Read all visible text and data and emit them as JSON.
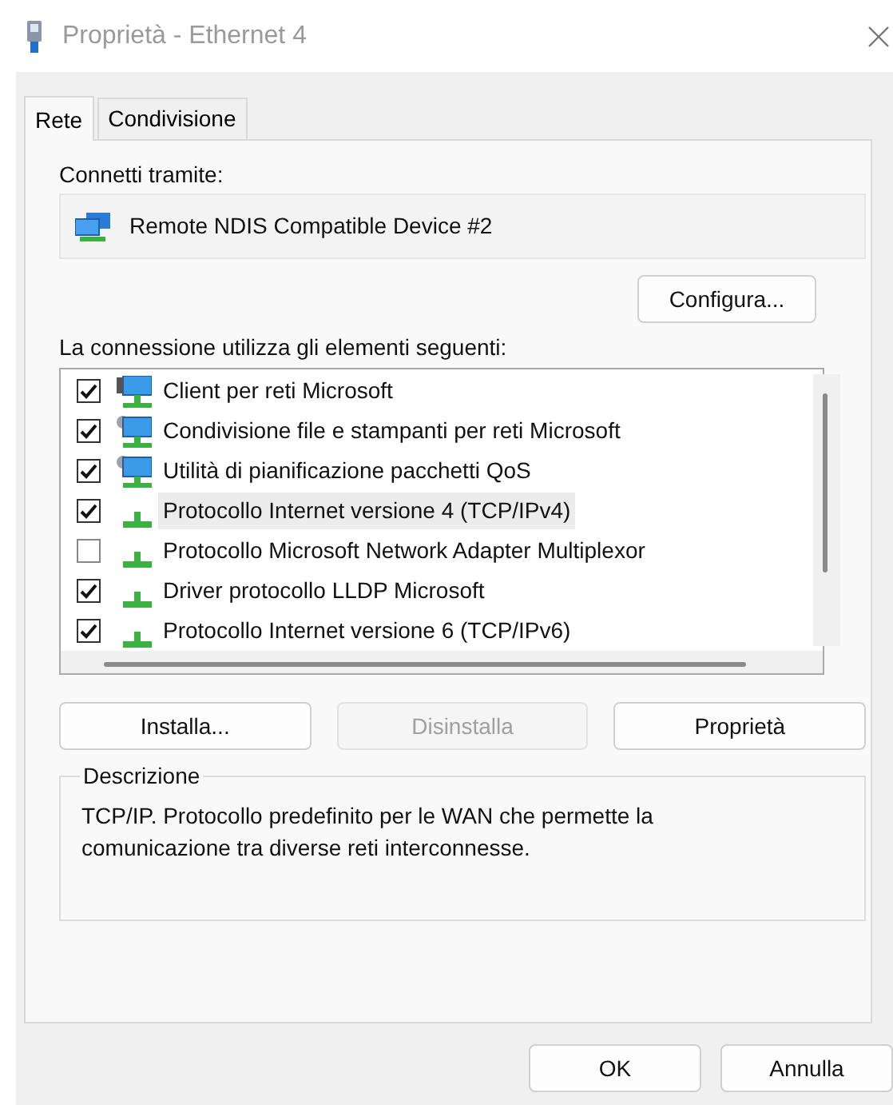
{
  "window": {
    "title": "Proprietà - Ethernet 4"
  },
  "tabs": [
    {
      "label": "Rete",
      "selected": true
    },
    {
      "label": "Condivisione",
      "selected": false
    }
  ],
  "connect_via": {
    "label": "Connetti tramite:",
    "device": "Remote NDIS Compatible Device #2"
  },
  "configure_button": "Configura...",
  "components": {
    "label": "La connessione utilizza gli elementi seguenti:",
    "items": [
      {
        "kind": "client",
        "label": "Client per reti Microsoft",
        "checked": true,
        "selected": false
      },
      {
        "kind": "service",
        "label": "Condivisione file e stampanti per reti Microsoft",
        "checked": true,
        "selected": false
      },
      {
        "kind": "service",
        "label": "Utilità di pianificazione pacchetti QoS",
        "checked": true,
        "selected": false
      },
      {
        "kind": "protocol",
        "label": "Protocollo Internet versione 4 (TCP/IPv4)",
        "checked": true,
        "selected": true
      },
      {
        "kind": "protocol",
        "label": "Protocollo Microsoft Network Adapter Multiplexor",
        "checked": false,
        "selected": false
      },
      {
        "kind": "protocol",
        "label": "Driver protocollo LLDP Microsoft",
        "checked": true,
        "selected": false
      },
      {
        "kind": "protocol",
        "label": "Protocollo Internet versione 6 (TCP/IPv6)",
        "checked": true,
        "selected": false
      }
    ]
  },
  "actions": [
    {
      "label": "Installa...",
      "disabled": false
    },
    {
      "label": "Disinstalla",
      "disabled": true
    },
    {
      "label": "Proprietà",
      "disabled": false
    }
  ],
  "description": {
    "label": "Descrizione",
    "text": "TCP/IP. Protocollo predefinito per le WAN che permette la comunicazione tra diverse reti interconnesse."
  },
  "buttons": [
    "OK",
    "Annulla"
  ]
}
